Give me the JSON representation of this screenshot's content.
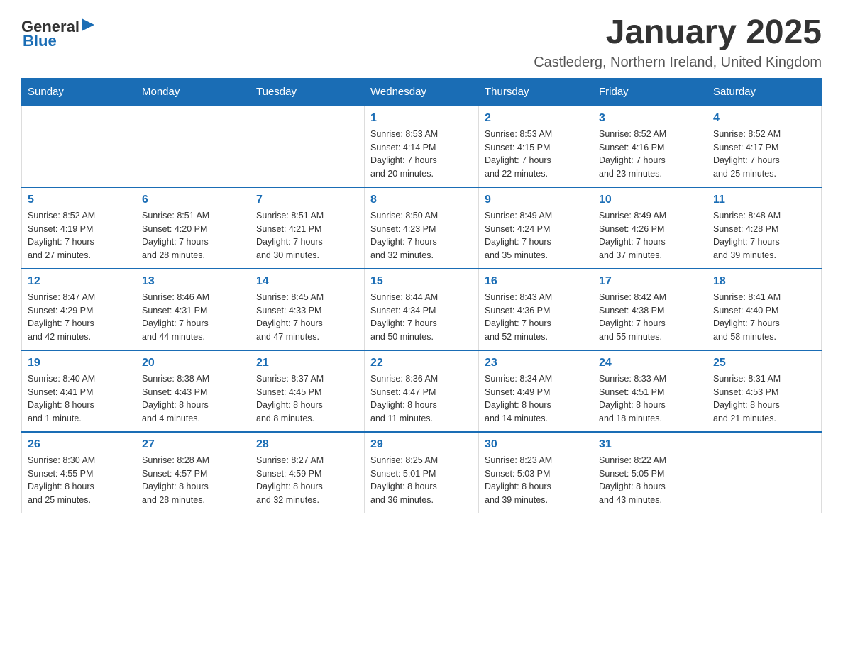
{
  "logo": {
    "general": "General",
    "blue": "Blue"
  },
  "header": {
    "month_title": "January 2025",
    "location": "Castlederg, Northern Ireland, United Kingdom"
  },
  "days_of_week": [
    "Sunday",
    "Monday",
    "Tuesday",
    "Wednesday",
    "Thursday",
    "Friday",
    "Saturday"
  ],
  "weeks": [
    [
      {
        "day": "",
        "info": ""
      },
      {
        "day": "",
        "info": ""
      },
      {
        "day": "",
        "info": ""
      },
      {
        "day": "1",
        "info": "Sunrise: 8:53 AM\nSunset: 4:14 PM\nDaylight: 7 hours\nand 20 minutes."
      },
      {
        "day": "2",
        "info": "Sunrise: 8:53 AM\nSunset: 4:15 PM\nDaylight: 7 hours\nand 22 minutes."
      },
      {
        "day": "3",
        "info": "Sunrise: 8:52 AM\nSunset: 4:16 PM\nDaylight: 7 hours\nand 23 minutes."
      },
      {
        "day": "4",
        "info": "Sunrise: 8:52 AM\nSunset: 4:17 PM\nDaylight: 7 hours\nand 25 minutes."
      }
    ],
    [
      {
        "day": "5",
        "info": "Sunrise: 8:52 AM\nSunset: 4:19 PM\nDaylight: 7 hours\nand 27 minutes."
      },
      {
        "day": "6",
        "info": "Sunrise: 8:51 AM\nSunset: 4:20 PM\nDaylight: 7 hours\nand 28 minutes."
      },
      {
        "day": "7",
        "info": "Sunrise: 8:51 AM\nSunset: 4:21 PM\nDaylight: 7 hours\nand 30 minutes."
      },
      {
        "day": "8",
        "info": "Sunrise: 8:50 AM\nSunset: 4:23 PM\nDaylight: 7 hours\nand 32 minutes."
      },
      {
        "day": "9",
        "info": "Sunrise: 8:49 AM\nSunset: 4:24 PM\nDaylight: 7 hours\nand 35 minutes."
      },
      {
        "day": "10",
        "info": "Sunrise: 8:49 AM\nSunset: 4:26 PM\nDaylight: 7 hours\nand 37 minutes."
      },
      {
        "day": "11",
        "info": "Sunrise: 8:48 AM\nSunset: 4:28 PM\nDaylight: 7 hours\nand 39 minutes."
      }
    ],
    [
      {
        "day": "12",
        "info": "Sunrise: 8:47 AM\nSunset: 4:29 PM\nDaylight: 7 hours\nand 42 minutes."
      },
      {
        "day": "13",
        "info": "Sunrise: 8:46 AM\nSunset: 4:31 PM\nDaylight: 7 hours\nand 44 minutes."
      },
      {
        "day": "14",
        "info": "Sunrise: 8:45 AM\nSunset: 4:33 PM\nDaylight: 7 hours\nand 47 minutes."
      },
      {
        "day": "15",
        "info": "Sunrise: 8:44 AM\nSunset: 4:34 PM\nDaylight: 7 hours\nand 50 minutes."
      },
      {
        "day": "16",
        "info": "Sunrise: 8:43 AM\nSunset: 4:36 PM\nDaylight: 7 hours\nand 52 minutes."
      },
      {
        "day": "17",
        "info": "Sunrise: 8:42 AM\nSunset: 4:38 PM\nDaylight: 7 hours\nand 55 minutes."
      },
      {
        "day": "18",
        "info": "Sunrise: 8:41 AM\nSunset: 4:40 PM\nDaylight: 7 hours\nand 58 minutes."
      }
    ],
    [
      {
        "day": "19",
        "info": "Sunrise: 8:40 AM\nSunset: 4:41 PM\nDaylight: 8 hours\nand 1 minute."
      },
      {
        "day": "20",
        "info": "Sunrise: 8:38 AM\nSunset: 4:43 PM\nDaylight: 8 hours\nand 4 minutes."
      },
      {
        "day": "21",
        "info": "Sunrise: 8:37 AM\nSunset: 4:45 PM\nDaylight: 8 hours\nand 8 minutes."
      },
      {
        "day": "22",
        "info": "Sunrise: 8:36 AM\nSunset: 4:47 PM\nDaylight: 8 hours\nand 11 minutes."
      },
      {
        "day": "23",
        "info": "Sunrise: 8:34 AM\nSunset: 4:49 PM\nDaylight: 8 hours\nand 14 minutes."
      },
      {
        "day": "24",
        "info": "Sunrise: 8:33 AM\nSunset: 4:51 PM\nDaylight: 8 hours\nand 18 minutes."
      },
      {
        "day": "25",
        "info": "Sunrise: 8:31 AM\nSunset: 4:53 PM\nDaylight: 8 hours\nand 21 minutes."
      }
    ],
    [
      {
        "day": "26",
        "info": "Sunrise: 8:30 AM\nSunset: 4:55 PM\nDaylight: 8 hours\nand 25 minutes."
      },
      {
        "day": "27",
        "info": "Sunrise: 8:28 AM\nSunset: 4:57 PM\nDaylight: 8 hours\nand 28 minutes."
      },
      {
        "day": "28",
        "info": "Sunrise: 8:27 AM\nSunset: 4:59 PM\nDaylight: 8 hours\nand 32 minutes."
      },
      {
        "day": "29",
        "info": "Sunrise: 8:25 AM\nSunset: 5:01 PM\nDaylight: 8 hours\nand 36 minutes."
      },
      {
        "day": "30",
        "info": "Sunrise: 8:23 AM\nSunset: 5:03 PM\nDaylight: 8 hours\nand 39 minutes."
      },
      {
        "day": "31",
        "info": "Sunrise: 8:22 AM\nSunset: 5:05 PM\nDaylight: 8 hours\nand 43 minutes."
      },
      {
        "day": "",
        "info": ""
      }
    ]
  ]
}
